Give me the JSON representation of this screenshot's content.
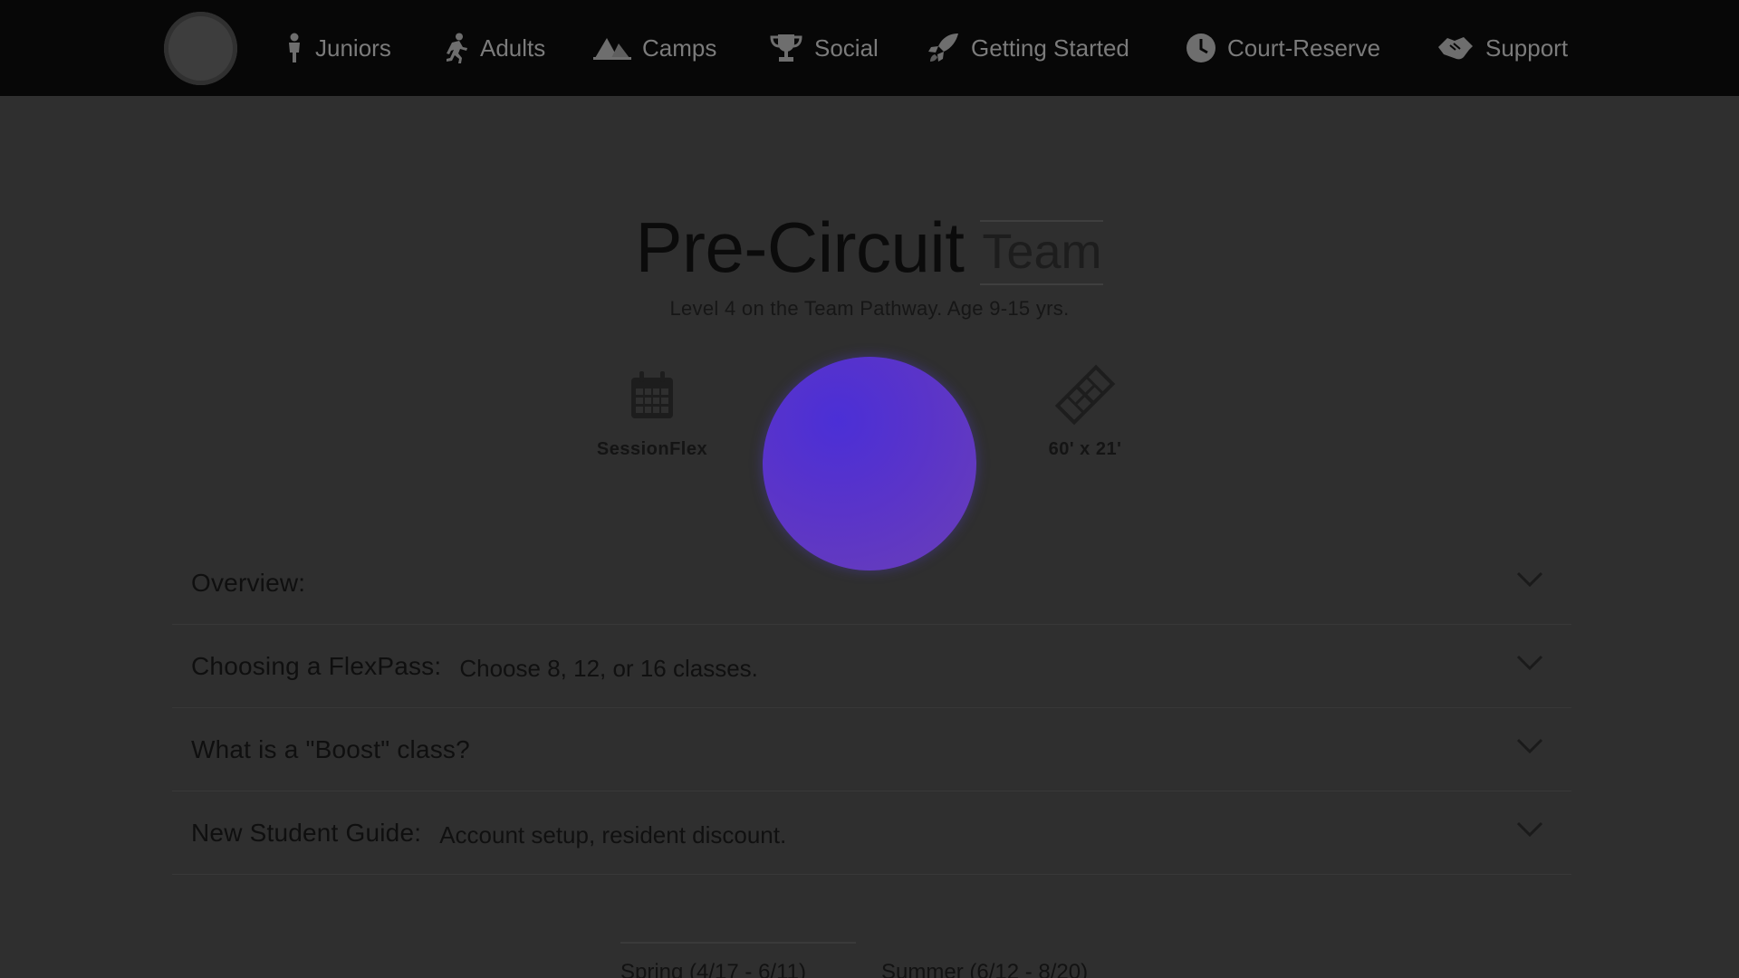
{
  "nav": {
    "items": [
      {
        "label": "Juniors",
        "icon": "child-icon"
      },
      {
        "label": "Adults",
        "icon": "running-person-icon"
      },
      {
        "label": "Camps",
        "icon": "tent-icon"
      },
      {
        "label": "Social",
        "icon": "trophy-icon"
      },
      {
        "label": "Getting Started",
        "icon": "rocket-icon"
      },
      {
        "label": "Court-Reserve",
        "icon": "clock-icon"
      },
      {
        "label": "Support",
        "icon": "handshake-icon"
      }
    ]
  },
  "program": {
    "title": "Pre-Circuit",
    "tag": "Team",
    "subtitle": "Level 4 on the Team Pathway. Age 9-15 yrs."
  },
  "features": [
    {
      "label": "SessionFlex",
      "icon": "calendar-icon"
    },
    {
      "label": "60' x 21'",
      "icon": "court-icon"
    }
  ],
  "accordion": [
    {
      "title": "Overview:",
      "desc": ""
    },
    {
      "title": "Choosing a FlexPass:",
      "desc": "Choose 8, 12, or 16 classes."
    },
    {
      "title": "What is a \"Boost\" class?",
      "desc": ""
    },
    {
      "title": "New Student Guide:",
      "desc": "Account setup, resident discount."
    }
  ],
  "seasons": {
    "spring": "Spring (4/17 - 6/11)",
    "summer": "Summer (6/12 - 8/20)"
  },
  "colors": {
    "nav_bg": "#070707",
    "page_overlay": "#2f2f2f",
    "loader": "#5a34c9"
  }
}
